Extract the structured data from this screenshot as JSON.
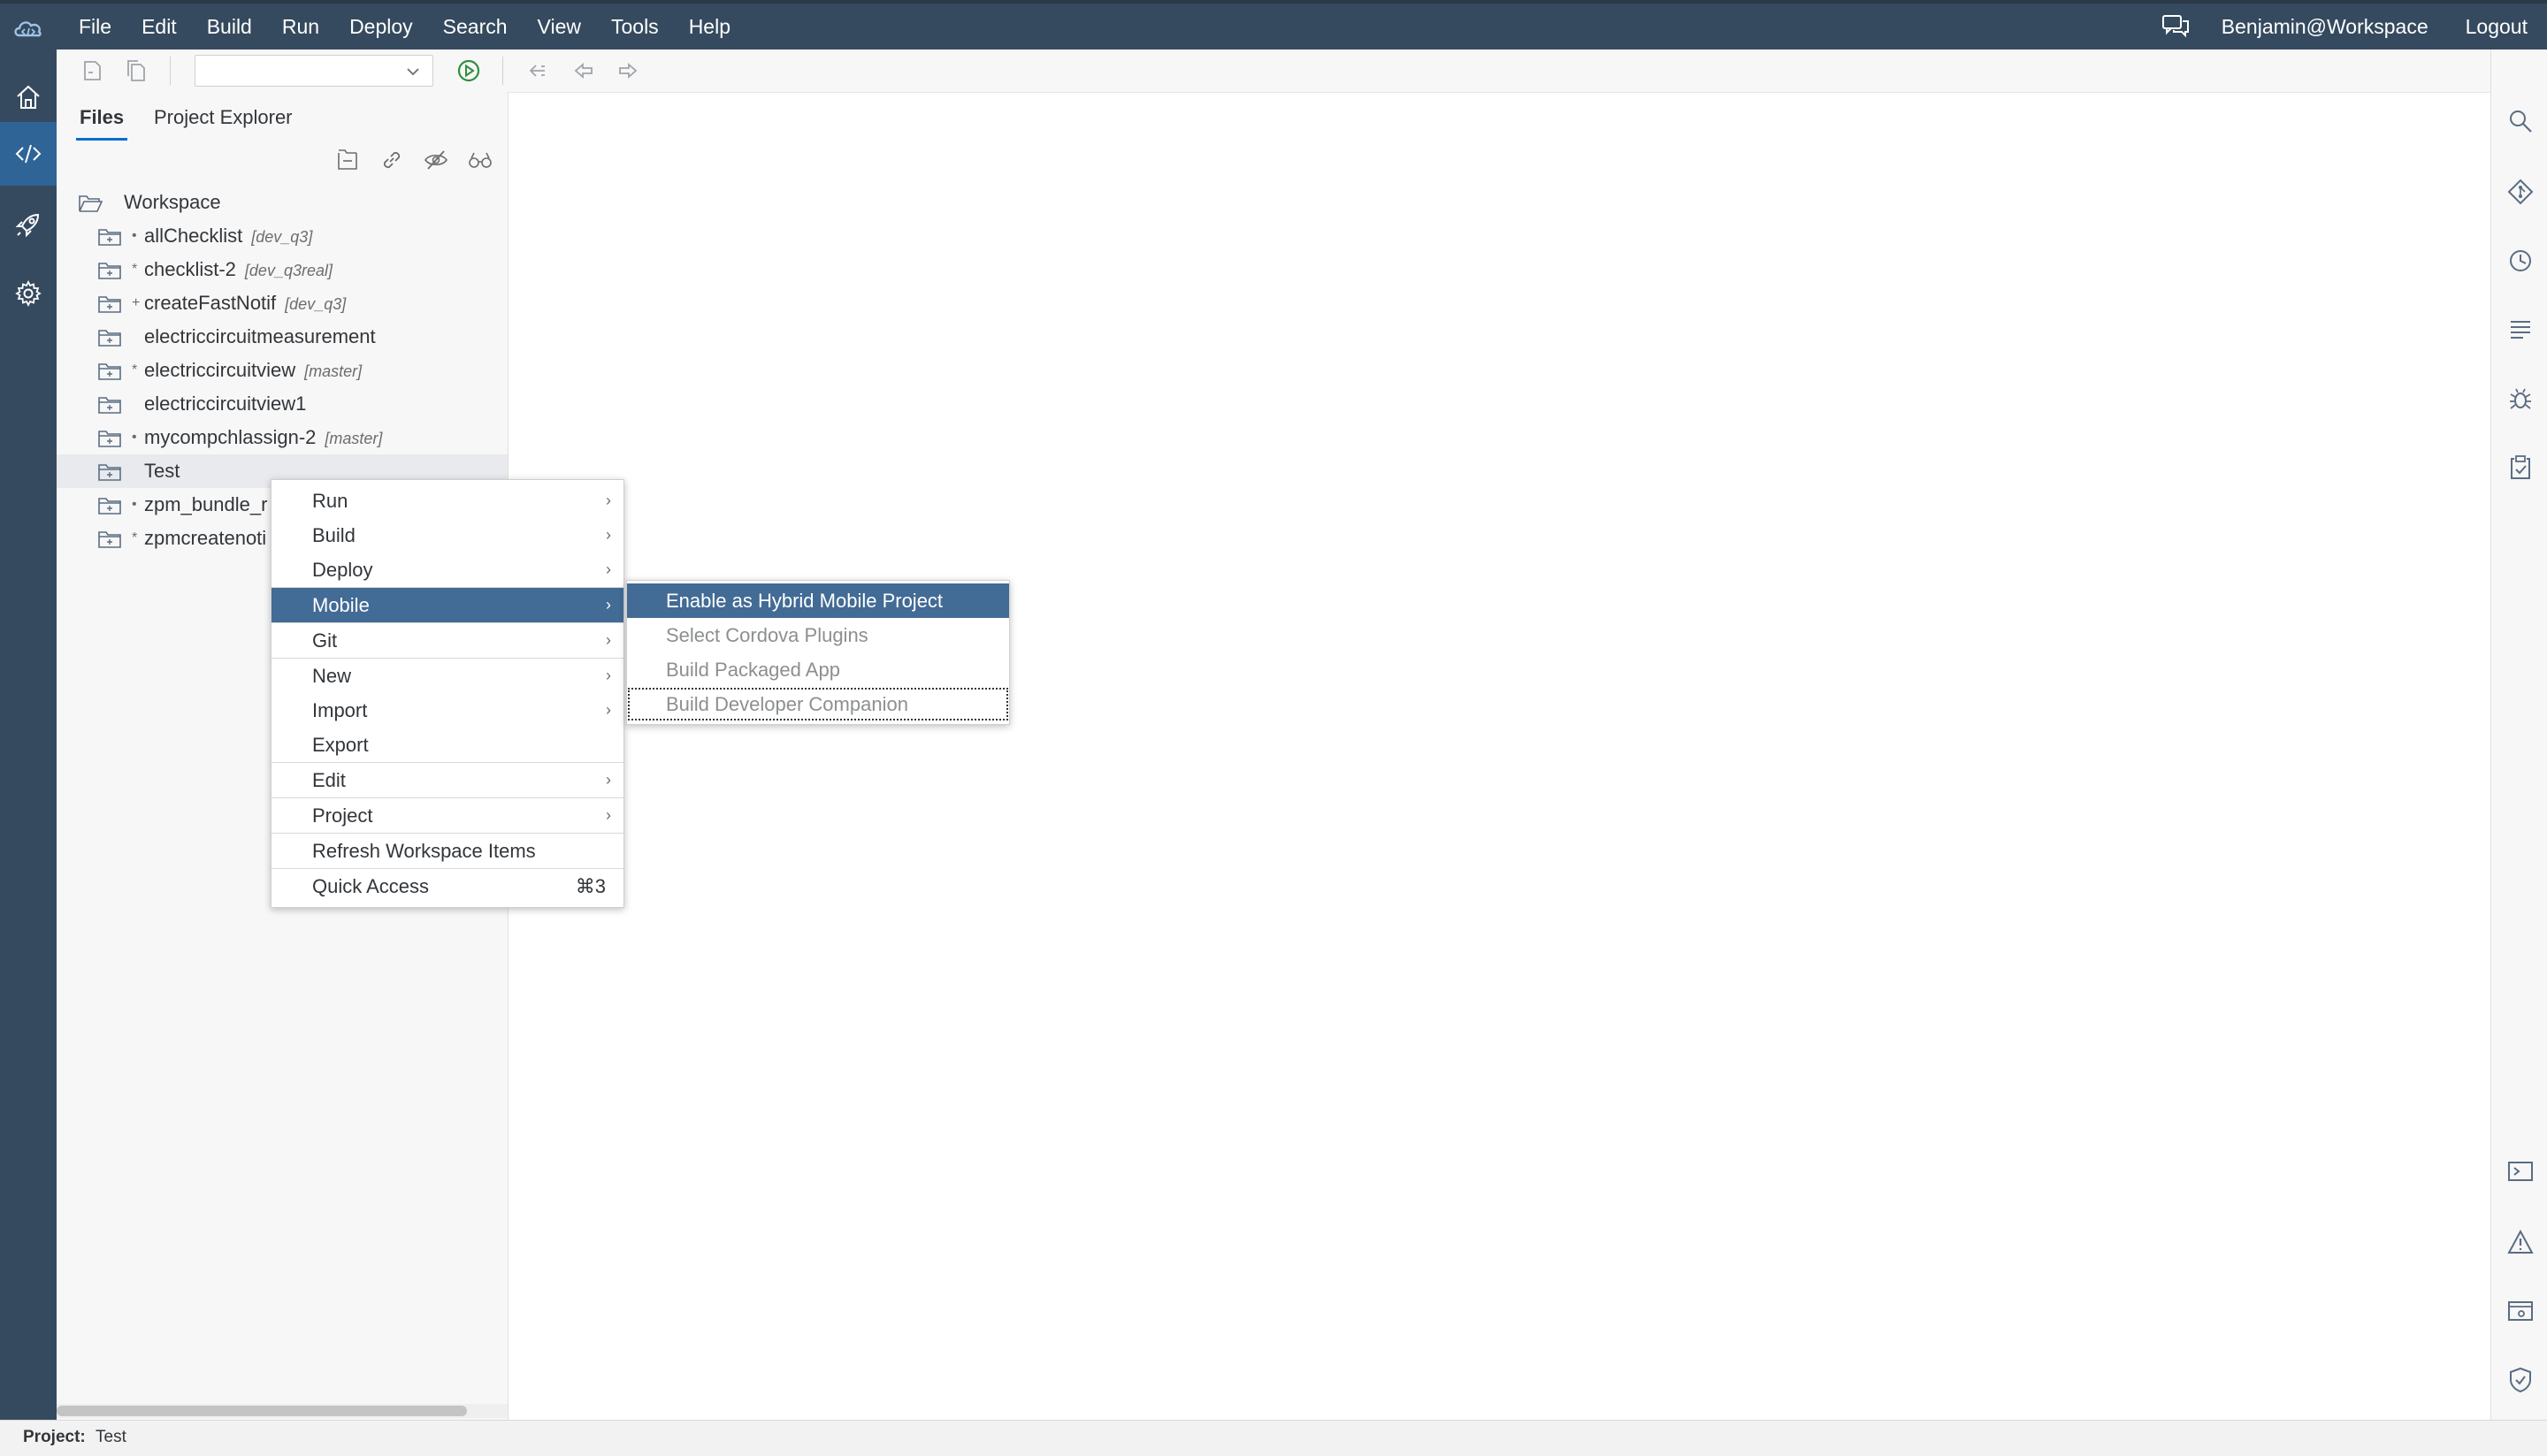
{
  "menubar": {
    "items": [
      "File",
      "Edit",
      "Build",
      "Run",
      "Deploy",
      "Search",
      "View",
      "Tools",
      "Help"
    ],
    "user": "Benjamin@Workspace",
    "logout": "Logout"
  },
  "panel": {
    "tabs": [
      "Files",
      "Project Explorer"
    ]
  },
  "tree": {
    "root": "Workspace",
    "items": [
      {
        "name": "allChecklist",
        "branch": "[dev_q3]",
        "mark": "•"
      },
      {
        "name": "checklist-2",
        "branch": "[dev_q3real]",
        "mark": "*"
      },
      {
        "name": "createFastNotif",
        "branch": "[dev_q3]",
        "mark": "+"
      },
      {
        "name": "electriccircuitmeasurement",
        "branch": "",
        "mark": ""
      },
      {
        "name": "electriccircuitview",
        "branch": "[master]",
        "mark": "*"
      },
      {
        "name": "electriccircuitview1",
        "branch": "",
        "mark": ""
      },
      {
        "name": "mycompchlassign-2",
        "branch": "[master]",
        "mark": "•"
      },
      {
        "name": "Test",
        "branch": "",
        "mark": ""
      },
      {
        "name": "zpm_bundle_r",
        "branch": "",
        "mark": "•"
      },
      {
        "name": "zpmcreatenoti",
        "branch": "",
        "mark": "*"
      }
    ]
  },
  "context_menu": {
    "items": [
      {
        "label": "Run",
        "has_submenu": true
      },
      {
        "label": "Build",
        "has_submenu": true
      },
      {
        "label": "Deploy",
        "has_submenu": true
      },
      {
        "label": "Mobile",
        "has_submenu": true
      },
      {
        "label": "Git",
        "has_submenu": true
      },
      {
        "label": "New",
        "has_submenu": true
      },
      {
        "label": "Import",
        "has_submenu": true
      },
      {
        "label": "Export",
        "has_submenu": false
      },
      {
        "label": "Edit",
        "has_submenu": true
      },
      {
        "label": "Project",
        "has_submenu": true
      },
      {
        "label": "Refresh Workspace Items",
        "has_submenu": false
      },
      {
        "label": "Quick Access",
        "has_submenu": false,
        "shortcut": "⌘3"
      }
    ],
    "highlighted": "Mobile"
  },
  "submenu": {
    "items": [
      {
        "label": "Enable as Hybrid Mobile Project",
        "state": "highlighted"
      },
      {
        "label": "Select Cordova Plugins",
        "state": "disabled"
      },
      {
        "label": "Build Packaged App",
        "state": "disabled"
      },
      {
        "label": "Build Developer Companion",
        "state": "disabled-focused"
      }
    ]
  },
  "statusbar": {
    "label": "Project:",
    "value": "Test"
  },
  "colors": {
    "shell": "#354a5f",
    "active_nav": "#2f6497",
    "highlight": "#426b95",
    "run_green": "#2f8f3a"
  },
  "icons": {
    "left": [
      "home-icon",
      "code-icon",
      "rocket-icon",
      "settings-icon"
    ],
    "right": [
      "search-icon",
      "git-icon",
      "history-icon",
      "outline-icon",
      "debug-icon",
      "clipboard-check-icon",
      "console-icon",
      "warning-icon",
      "preview-icon",
      "shield-icon"
    ]
  }
}
